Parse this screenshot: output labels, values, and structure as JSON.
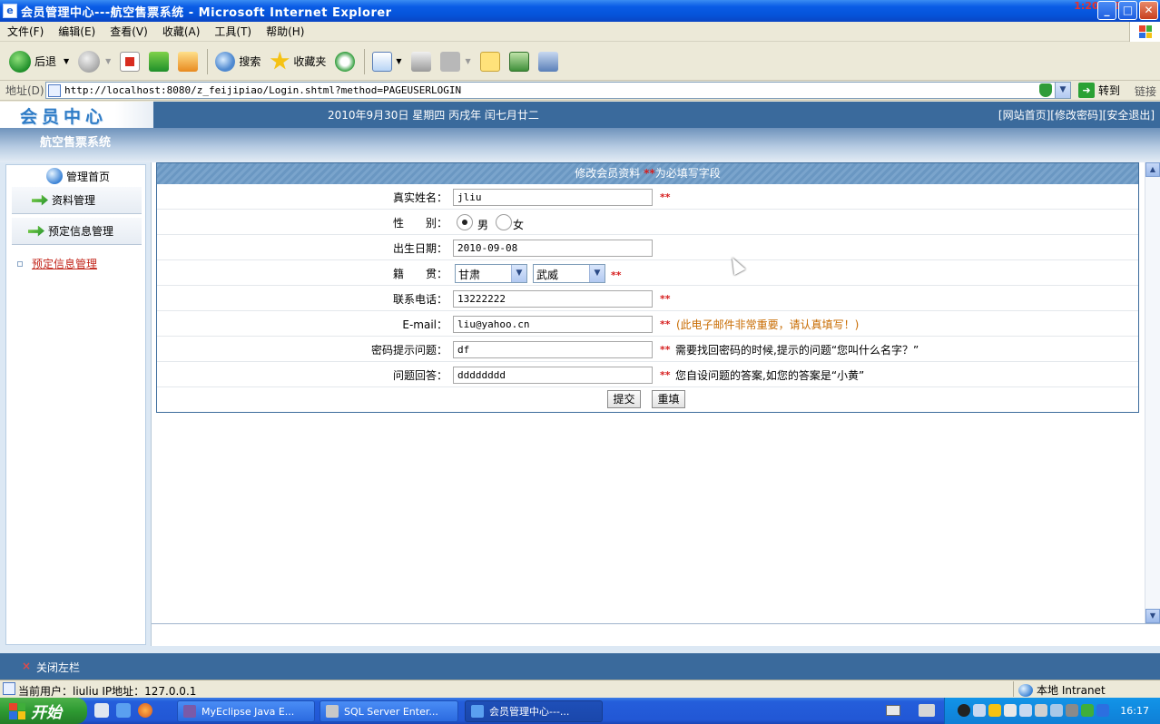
{
  "window": {
    "title": "会员管理中心---航空售票系统 - Microsoft Internet Explorer",
    "overlay_time": "1:20/2:50",
    "minimize": "_",
    "maximize": "□",
    "close": "✕"
  },
  "menu": {
    "items": [
      "文件(F)",
      "编辑(E)",
      "查看(V)",
      "收藏(A)",
      "工具(T)",
      "帮助(H)"
    ]
  },
  "toolbar": {
    "back": "后退",
    "search": "搜索",
    "favorites": "收藏夹"
  },
  "address": {
    "label": "地址(D)",
    "url": "http://localhost:8080/z_feijipiao/Login.shtml?method=PAGEUSERLOGIN",
    "go": "转到",
    "links": "链接"
  },
  "header": {
    "logo": "会员中心",
    "date": "2010年9月30日 星期四 丙戌年 闰七月廿二",
    "links": "[网站首页][修改密码][安全退出]",
    "system_title": "航空售票系统"
  },
  "sidebar": {
    "home": "管理首页",
    "items": [
      "资料管理",
      "预定信息管理"
    ],
    "link": "预定信息管理"
  },
  "form": {
    "title": "修改会员资料",
    "title_req": "**",
    "title_suffix": "为必填写字段",
    "req": "**",
    "realname": {
      "label": "真实姓名：",
      "value": "jliu"
    },
    "gender": {
      "label": "性　　别：",
      "male": "男",
      "female": "女"
    },
    "birthday": {
      "label": "出生日期：",
      "value": "2010-09-08"
    },
    "origin": {
      "label": "籍　　贯：",
      "province": "甘肃",
      "city": "武威"
    },
    "phone": {
      "label": "联系电话：",
      "value": "13222222"
    },
    "email": {
      "label": "E-mail：",
      "value": "liu@yahoo.cn",
      "hint": "(此电子邮件非常重要，请认真填写！)"
    },
    "question": {
      "label": "密码提示问题：",
      "value": "df",
      "hint": "需要找回密码的时候,提示的问题“您叫什么名字？”"
    },
    "answer": {
      "label": "问题回答：",
      "value": "dddddddd",
      "hint": "您自设问题的答案,如您的答案是“小黄”"
    },
    "submit": "提交",
    "reset": "重填"
  },
  "bottom": {
    "close_sidebar": "关闭左栏",
    "close_x": "×"
  },
  "status": {
    "text": "当前用户：liuliu  IP地址：127.0.0.1",
    "zone": "本地 Intranet"
  },
  "taskbar": {
    "start": "开始",
    "tasks": [
      "MyEclipse Java E...",
      "SQL Server Enter...",
      "会员管理中心---..."
    ],
    "clock": "16:17"
  }
}
